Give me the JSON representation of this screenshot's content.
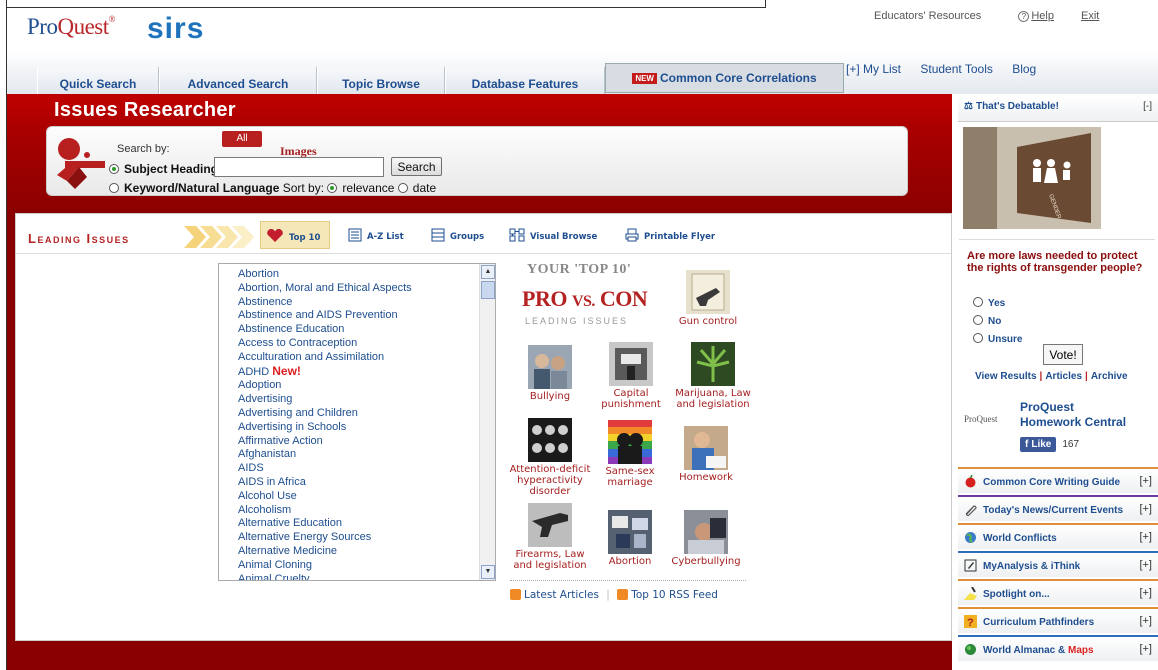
{
  "header": {
    "logo_pq_pro": "Pro",
    "logo_pq_quest": "Quest",
    "logo_sirs": "sirs",
    "toplinks": [
      "Educators' Resources",
      "Help",
      "Exit"
    ],
    "tabs": [
      "Quick Search",
      "Advanced Search",
      "Topic Browse",
      "Database Features",
      "Common Core Correlations"
    ],
    "new_badge": "NEW",
    "navlinks": [
      "[+] My List",
      "Student Tools",
      "Blog"
    ]
  },
  "search": {
    "app_title": "Issues Researcher",
    "search_by_label": "Search by:",
    "all_badge": "All",
    "images_label": "Images",
    "option_subject": "Subject Headings",
    "option_keyword": "Keyword/Natural Language",
    "sort_by_label": "Sort by:",
    "sort_relevance": "relevance",
    "sort_date": "date",
    "search_button": "Search",
    "query_value": ""
  },
  "leading_issues": {
    "title": "Leading Issues",
    "tools": [
      "Top 10",
      "A-Z List",
      "Groups",
      "Visual Browse",
      "Printable Flyer"
    ],
    "issues": [
      "Abortion",
      "Abortion, Moral and Ethical Aspects",
      "Abstinence",
      "Abstinence and AIDS Prevention",
      "Abstinence Education",
      "Access to Contraception",
      "Acculturation and Assimilation",
      "ADHD",
      "Adoption",
      "Advertising",
      "Advertising and Children",
      "Advertising in Schools",
      "Affirmative Action",
      "Afghanistan",
      "AIDS",
      "AIDS in Africa",
      "Alcohol Use",
      "Alcoholism",
      "Alternative Education",
      "Alternative Energy Sources",
      "Alternative Medicine",
      "Animal Cloning",
      "Animal Cruelty"
    ],
    "new_tag": "New!"
  },
  "top10": {
    "heading1": "YOUR 'TOP 10'",
    "heading2_a": "PRO",
    "heading2_b": "VS.",
    "heading2_c": "CON",
    "heading3": "LEADING ISSUES",
    "items": [
      "Gun control",
      "Bullying",
      "Capital punishment",
      "Marijuana, Law and legislation",
      "Attention-deficit hyperactivity disorder",
      "Same-sex marriage",
      "Homework",
      "Firearms, Law and legislation",
      "Abortion",
      "Cyberbullying"
    ],
    "rss_latest": "Latest Articles",
    "rss_top10": "Top 10 RSS Feed"
  },
  "sidebar": {
    "debatable_title": "That's Debatable!",
    "collapse": "[-]",
    "poll_question": "Are more laws needed to protect the rights of transgender people?",
    "poll_options": [
      "Yes",
      "No",
      "Unsure"
    ],
    "vote_button": "Vote!",
    "poll_links": [
      "View Results",
      "Articles",
      "Archive"
    ],
    "hwc_logo": "ProQuest",
    "hwc_title_1": "ProQuest",
    "hwc_title_2": "Homework Central",
    "fb_like": "Like",
    "fb_count": "167",
    "sections": [
      "Common Core Writing Guide",
      "Today's News/Current Events",
      "World Conflicts",
      "MyAnalysis & iThink",
      "Spotlight on...",
      "Curriculum Pathfinders",
      "World Almanac & "
    ],
    "maps_label": "Maps",
    "expand": "[+]"
  },
  "colors": {
    "brand_red": "#b52222",
    "link_blue": "#1e4e8f",
    "section_borders": [
      "#e0903a",
      "#6a3aa0",
      "#e0903a",
      "#2f6fba",
      "#e0903a",
      "#e0903a",
      "#2f6fba"
    ]
  }
}
